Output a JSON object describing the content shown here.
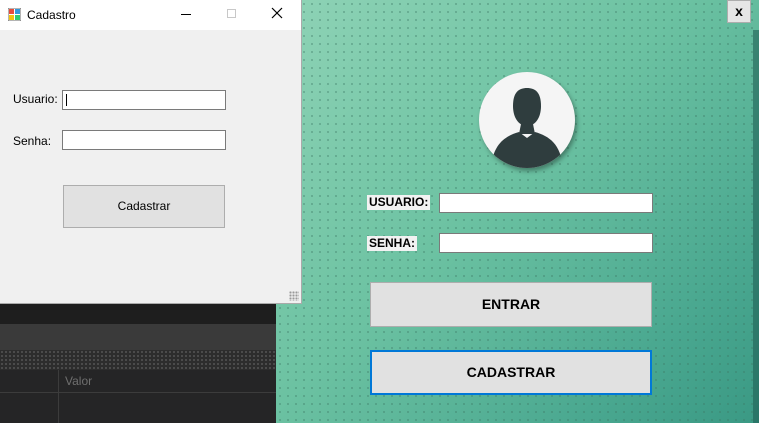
{
  "cadastro_window": {
    "title": "Cadastro",
    "usuario_label": "Usuario:",
    "senha_label": "Senha:",
    "usuario_value": "",
    "senha_value": "",
    "cadastrar_button": "Cadastrar"
  },
  "background_app": {
    "grid_column_header": "Valor"
  },
  "login_panel": {
    "close_button": "x",
    "usuario_label": "USUARIO:",
    "senha_label": "SENHA:",
    "usuario_value": "",
    "senha_value": "",
    "entrar_button": "ENTRAR",
    "cadastrar_button": "CADASTRAR"
  }
}
